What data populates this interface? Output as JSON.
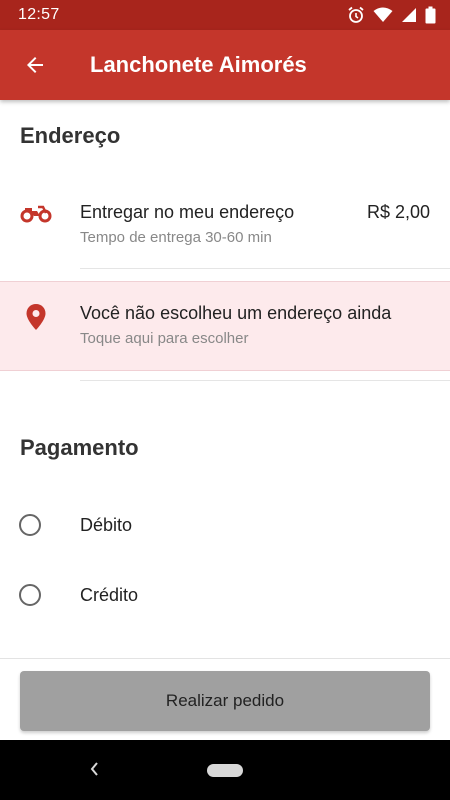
{
  "status_bar": {
    "time": "12:57"
  },
  "header": {
    "title": "Lanchonete Aimorés"
  },
  "address": {
    "section_title": "Endereço",
    "delivery": {
      "title": "Entregar no meu endereço",
      "subtitle": "Tempo de entrega 30-60 min",
      "price": "R$ 2,00",
      "icon": "motorcycle-icon"
    },
    "warning": {
      "title": "Você não escolheu um endereço ainda",
      "subtitle": "Toque aqui para escolher",
      "icon": "location-pin-icon"
    }
  },
  "payment": {
    "section_title": "Pagamento",
    "options": [
      {
        "label": "Débito",
        "selected": false
      },
      {
        "label": "Crédito",
        "selected": false
      }
    ]
  },
  "footer": {
    "order_button": "Realizar pedido"
  },
  "colors": {
    "primary": "#c4362b",
    "status_bar": "#a8251c",
    "warning_background": "#fdeaec",
    "button_disabled": "#a0a0a0"
  }
}
